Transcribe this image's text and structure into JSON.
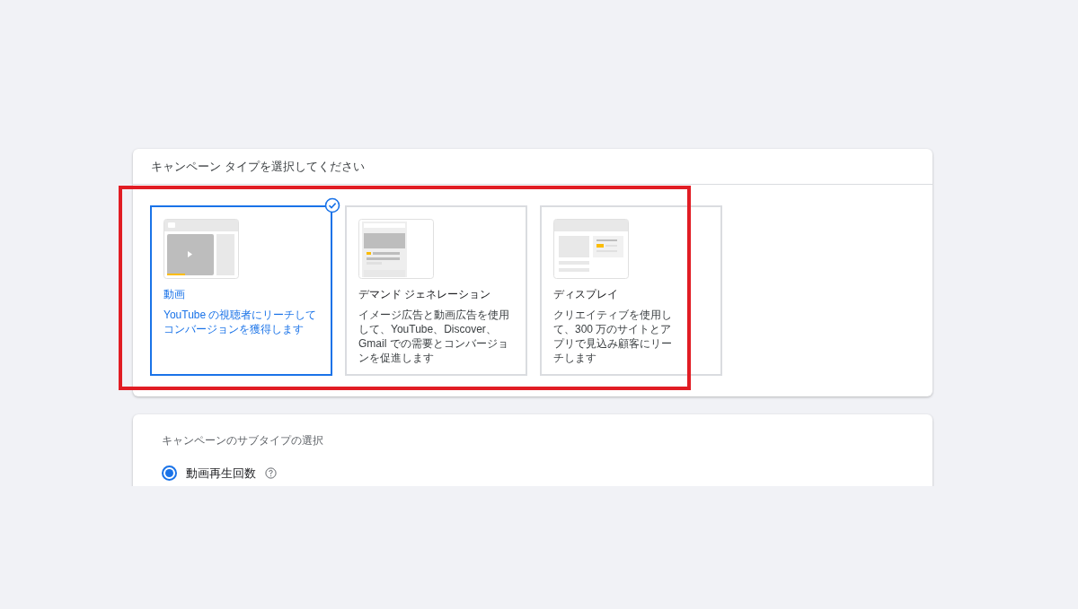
{
  "type_panel": {
    "title": "キャンペーン タイプを選択してください",
    "cards": [
      {
        "kind": "video",
        "title": "動画",
        "description": "YouTube の視聴者にリーチしてコンバージョンを獲得します",
        "selected": true
      },
      {
        "kind": "demand",
        "title": "デマンド ジェネレーション",
        "description": "イメージ広告と動画広告を使用して、YouTube、Discover、Gmail での需要とコンバージョンを促進します",
        "selected": false
      },
      {
        "kind": "display",
        "title": "ディスプレイ",
        "description": "クリエイティブを使用して、300 万のサイトとアプリで見込み顧客にリーチします",
        "selected": false
      }
    ]
  },
  "subtype_panel": {
    "title": "キャンペーンのサブタイプの選択",
    "options": [
      {
        "label": "動画再生回数",
        "help": true,
        "selected": true
      }
    ]
  }
}
